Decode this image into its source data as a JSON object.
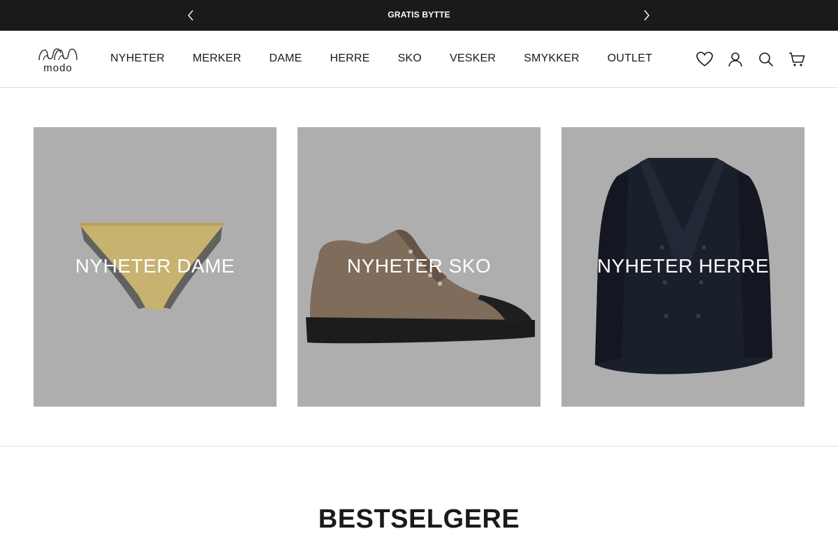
{
  "announcement": {
    "text": "GRATIS BYTTE",
    "prev_icon": "chevron-left-icon",
    "next_icon": "chevron-right-icon"
  },
  "header": {
    "logo_text": "modo",
    "nav": [
      {
        "label": "NYHETER"
      },
      {
        "label": "MERKER"
      },
      {
        "label": "DAME"
      },
      {
        "label": "HERRE"
      },
      {
        "label": "SKO"
      },
      {
        "label": "VESKER"
      },
      {
        "label": "SMYKKER"
      },
      {
        "label": "OUTLET"
      }
    ],
    "icons": [
      "heart-icon",
      "account-icon",
      "search-icon",
      "cart-icon"
    ]
  },
  "collections": [
    {
      "label": "NYHETER DAME",
      "image": "lingerie-brief-image"
    },
    {
      "label": "NYHETER SKO",
      "image": "hiking-shoe-image"
    },
    {
      "label": "NYHETER HERRE",
      "image": "blazer-image"
    }
  ],
  "bestsellers": {
    "title": "BESTSELGERE"
  },
  "colors": {
    "announcement_bg": "#1a1a1a",
    "tile_bg": "#bdbdbd",
    "text": "#1a1a1a"
  }
}
